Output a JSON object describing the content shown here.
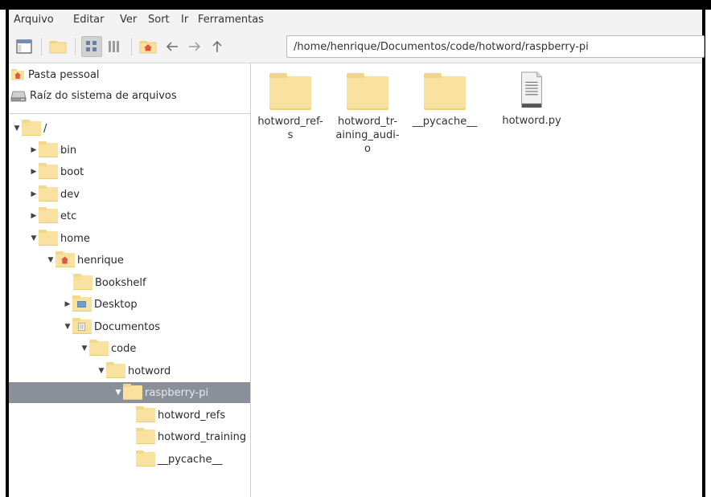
{
  "menubar": {
    "items": [
      "Arquivo",
      "Editar",
      "Ver",
      "Sort",
      "Ir",
      "Ferramentas"
    ]
  },
  "toolbar": {
    "path": "/home/henrique/Documentos/code/hotword/raspberry-pi",
    "active_view": "icon-view"
  },
  "sidebar": {
    "places": [
      {
        "label": "Pasta pessoal",
        "icon": "home-icon"
      },
      {
        "label": "Raíz do sistema de arquivos",
        "icon": "drive-icon"
      }
    ],
    "tree": [
      {
        "label": "/",
        "expanded": true
      },
      {
        "label": "bin",
        "expanded": false
      },
      {
        "label": "boot",
        "expanded": false
      },
      {
        "label": "dev",
        "expanded": false
      },
      {
        "label": "etc",
        "expanded": false
      },
      {
        "label": "home",
        "expanded": true
      },
      {
        "label": "henrique",
        "expanded": true,
        "icon": "home-folder-icon"
      },
      {
        "label": "Bookshelf"
      },
      {
        "label": "Desktop",
        "expanded": false,
        "icon": "desktop-folder-icon"
      },
      {
        "label": "Documentos",
        "expanded": true,
        "icon": "documents-folder-icon"
      },
      {
        "label": "code",
        "expanded": true
      },
      {
        "label": "hotword",
        "expanded": true
      },
      {
        "label": "raspberry-pi",
        "expanded": true,
        "selected": true
      },
      {
        "label": "hotword_refs"
      },
      {
        "label": "hotword_training"
      },
      {
        "label": "__pycache__"
      }
    ]
  },
  "files": [
    {
      "line1": "hotword_ref-",
      "line2": "s",
      "line3": "",
      "type": "folder"
    },
    {
      "line1": "hotword_tr-",
      "line2": "aining_audi-",
      "line3": "o",
      "type": "folder"
    },
    {
      "line1": "__pycache__",
      "line2": "",
      "line3": "",
      "type": "folder"
    },
    {
      "line1": "hotword.py",
      "line2": "",
      "line3": "",
      "type": "text-file"
    }
  ],
  "colors": {
    "folder": "#f9e29f",
    "selection": "#8a9099",
    "home_badge": "#e2573b",
    "toolbar_bg": "#f3f3f3"
  }
}
